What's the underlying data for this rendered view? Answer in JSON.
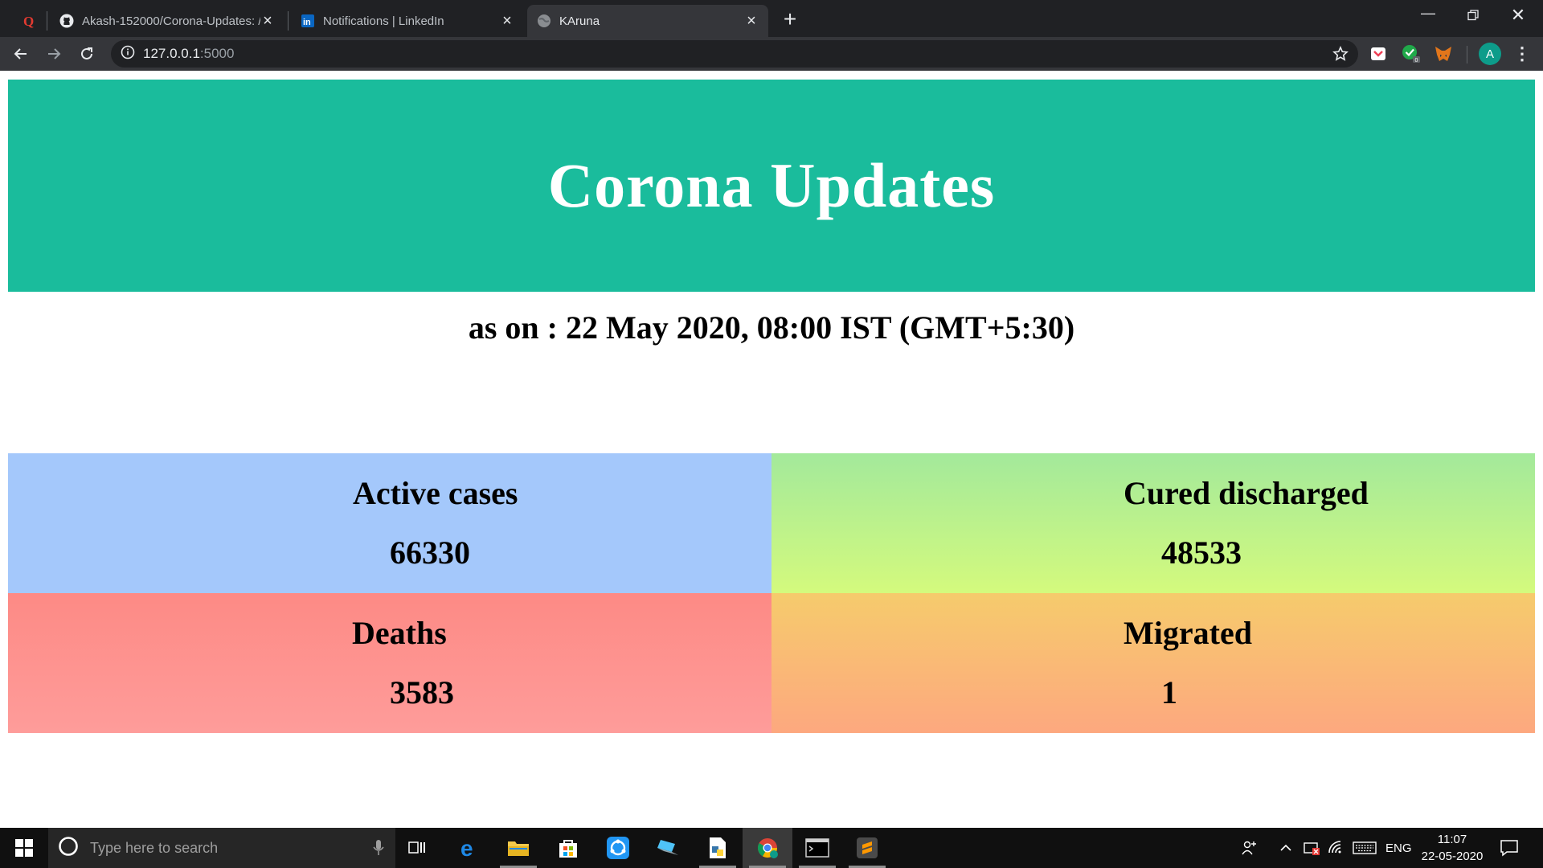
{
  "browser": {
    "tabs": [
      {
        "title": "Akash-152000/Corona-Updates: /",
        "icon": "github-icon"
      },
      {
        "title": "Notifications | LinkedIn",
        "icon": "linkedin-icon"
      },
      {
        "title": "KAruna",
        "icon": "globe-icon",
        "active": true
      }
    ],
    "address": {
      "host": "127.0.0.1",
      "port": ":5000"
    },
    "profile_initial": "A"
  },
  "page": {
    "title": "Corona Updates",
    "as_on": "as on : 22 May 2020, 08:00 IST (GMT+5:30)",
    "stats": {
      "active": {
        "label": "Active cases",
        "value": "66330"
      },
      "cured": {
        "label": "Cured discharged",
        "value": "48533"
      },
      "deaths": {
        "label": "Deaths",
        "value": "3583"
      },
      "migrated": {
        "label": "Migrated",
        "value": "1"
      }
    },
    "colors": {
      "header": "#1abc9c",
      "active": "#a4c8fb",
      "cured": "#c0f28a",
      "deaths": "#fe8f8c",
      "migrated": "#f9b977"
    }
  },
  "taskbar": {
    "search_placeholder": "Type here to search",
    "language": "ENG",
    "time": "11:07",
    "date": "22-05-2020"
  }
}
